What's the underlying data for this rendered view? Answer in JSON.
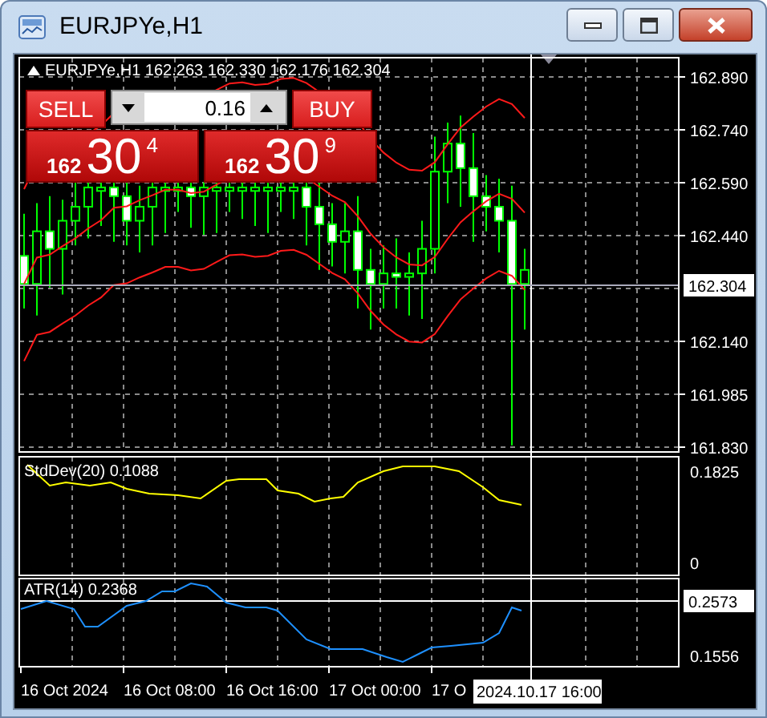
{
  "window": {
    "title": "EURJPYe,H1",
    "buttons": [
      {
        "kind": "minimize"
      },
      {
        "kind": "maximize"
      },
      {
        "kind": "close"
      }
    ]
  },
  "chart": {
    "header": "EURJPYe,H1  162.263 162.330 162.176 162.304",
    "trade_panel": {
      "sell_label": "SELL",
      "buy_label": "BUY",
      "volume": "0.16",
      "sell_price": {
        "big_figure": "162",
        "pips": "30",
        "fraction": "4"
      },
      "buy_price": {
        "big_figure": "162",
        "pips": "30",
        "fraction": "9"
      }
    },
    "price_axis": [
      "162.890",
      "162.740",
      "162.590",
      "162.440",
      "162.140",
      "161.985",
      "161.830"
    ],
    "current_price": "162.304",
    "indicators": [
      {
        "label": "StdDev(20) 0.1088",
        "axis": [
          "0.1825",
          "0"
        ]
      },
      {
        "label": "ATR(14) 0.2368",
        "axis": [
          "0.1556"
        ],
        "crosshair_value": "0.2573"
      }
    ],
    "time_axis": [
      "16 Oct 2024",
      "16 Oct 08:00",
      "16 Oct 16:00",
      "17 Oct 00:00",
      "17 O"
    ],
    "crosshair_time": "2024.10.17 16:00"
  }
}
